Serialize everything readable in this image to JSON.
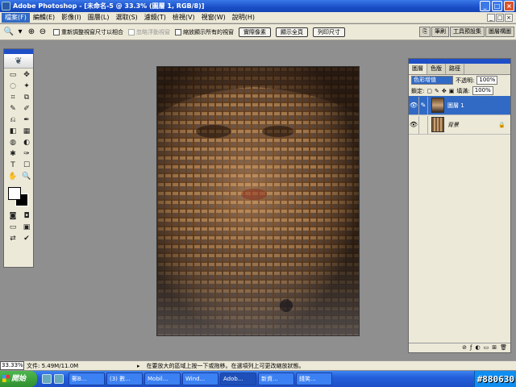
{
  "title": "Adobe Photoshop - [未命名-5 @ 33.3% (圖層 1, RGB/8)]",
  "window_buttons": [
    "_",
    "□",
    "×"
  ],
  "menu": [
    "檔案(F)",
    "編輯(E)",
    "影像(I)",
    "圖層(L)",
    "選取(S)",
    "濾鏡(T)",
    "檢視(V)",
    "視窗(W)",
    "說明(H)"
  ],
  "mdi_buttons": [
    "_",
    "□",
    "×"
  ],
  "options": {
    "zoom_icon": "🔍",
    "resize_windows": "重新調整視窗尺寸以相合",
    "ignore_palettes": "忽略浮動視窗",
    "zoom_all": "縮放顯示所有的視窗",
    "actual_pixels": "實際像素",
    "fit_screen": "顯示全頁",
    "print_size": "列印尺寸",
    "wells": [
      "筆刷",
      "工具預設集",
      "圖層構圖"
    ]
  },
  "tools": [
    "▭",
    "✥",
    "◌",
    "✦",
    "⌗",
    "⧉",
    "✎",
    "✐",
    "⎌",
    "✒",
    "◧",
    "▦",
    "◍",
    "◐",
    "✱",
    "✑",
    "T",
    "☐",
    "✋",
    "🔍"
  ],
  "toolbox_bottom": [
    "◙",
    "◘",
    "▭",
    "▣",
    "⇄",
    "✔"
  ],
  "layers_panel": {
    "tabs": [
      "圖層",
      "色版",
      "路徑"
    ],
    "blend_mode": "色彩增值",
    "opacity_label": "不透明:",
    "opacity": "100%",
    "lock_label": "鎖定:",
    "fill_label": "填滿:",
    "fill": "100%",
    "layers": [
      {
        "name": "圖層 1",
        "active": true
      },
      {
        "name": "背景",
        "active": false,
        "locked": true
      }
    ],
    "footer_icons": [
      "⊘",
      "ƒ",
      "◐",
      "▭",
      "⊞",
      "🗑"
    ]
  },
  "status": {
    "zoom": "33.33%",
    "doc_size": "文件: 5.49M/11.0M",
    "tip": "在要放大的區域上按一下或拖移。在選項列上可更改縮放狀態。"
  },
  "taskbar": {
    "start": "開始",
    "tasks": [
      "郵B...",
      "(3) 數...",
      "Mobil...",
      "Wind...",
      "Adob...",
      "新資...",
      "錢笑..."
    ],
    "tray": "#880630"
  },
  "watermark": "#880630"
}
